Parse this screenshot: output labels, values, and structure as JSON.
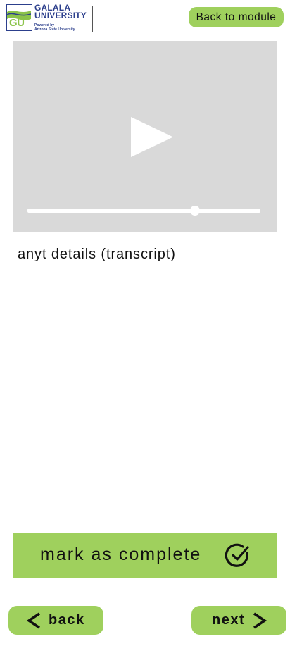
{
  "header": {
    "logo": {
      "name_line1": "GALALA",
      "name_line2": "UNIVERSITY",
      "sub_line1": "Powered by",
      "sub_line2": "Arizona State University",
      "badge_text": "GU",
      "brand_color": "#2c3f8c",
      "accent_color": "#8bc34a"
    },
    "back_to_module_label": "Back to module"
  },
  "video": {
    "play_icon": "play-icon",
    "progress_fraction": 0.72,
    "background_color": "#d9d9d9"
  },
  "transcript": {
    "text": "anyt details (transcript)"
  },
  "actions": {
    "mark_complete_label": "mark as complete",
    "mark_complete_icon": "check-circle-icon"
  },
  "nav": {
    "back_label": "back",
    "back_icon": "chevron-left-icon",
    "next_label": "next",
    "next_icon": "chevron-right-icon"
  },
  "colors": {
    "accent_green": "#9fd05d",
    "text": "#111111"
  }
}
